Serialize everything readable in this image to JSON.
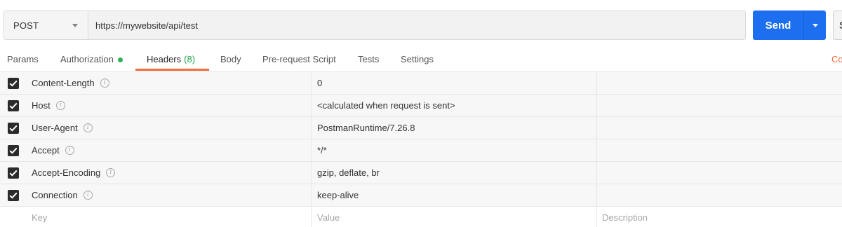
{
  "request": {
    "method": "POST",
    "url": "https://mywebsite/api/test"
  },
  "send_button": {
    "label": "Send"
  },
  "save_button": {
    "label": "S"
  },
  "tabs": [
    {
      "label": "Params"
    },
    {
      "label": "Authorization"
    },
    {
      "label": "Headers",
      "count": "(8)"
    },
    {
      "label": "Body"
    },
    {
      "label": "Pre-request Script"
    },
    {
      "label": "Tests"
    },
    {
      "label": "Settings"
    }
  ],
  "cookies_link": "Co",
  "headers": [
    {
      "key": "Content-Length",
      "value": "0",
      "checked": true
    },
    {
      "key": "Host",
      "value": "<calculated when request is sent>",
      "checked": true
    },
    {
      "key": "User-Agent",
      "value": "PostmanRuntime/7.26.8",
      "checked": true
    },
    {
      "key": "Accept",
      "value": "*/*",
      "checked": true
    },
    {
      "key": "Accept-Encoding",
      "value": "gzip, deflate, br",
      "checked": true
    },
    {
      "key": "Connection",
      "value": "keep-alive",
      "checked": true
    }
  ],
  "new_row": {
    "key_placeholder": "Key",
    "value_placeholder": "Value",
    "description_placeholder": "Description"
  },
  "colors": {
    "accent": "#f26b3a",
    "send": "#1d6ff0",
    "status_green": "#2eb35a"
  }
}
